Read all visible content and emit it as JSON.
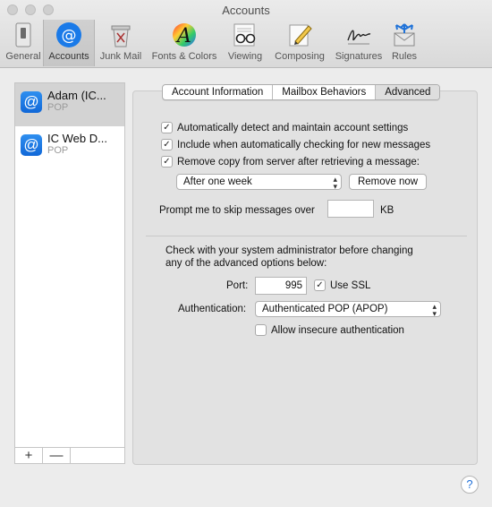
{
  "window": {
    "title": "Accounts"
  },
  "toolbar": {
    "tabs": [
      {
        "label": "General",
        "icon": "switch-icon",
        "selected": false
      },
      {
        "label": "Accounts",
        "icon": "at-sign-icon",
        "selected": true
      },
      {
        "label": "Junk Mail",
        "icon": "trash-can-icon",
        "selected": false
      },
      {
        "label": "Fonts & Colors",
        "icon": "color-font-icon",
        "selected": false
      },
      {
        "label": "Viewing",
        "icon": "glasses-icon",
        "selected": false
      },
      {
        "label": "Composing",
        "icon": "pencil-icon",
        "selected": false
      },
      {
        "label": "Signatures",
        "icon": "signature-icon",
        "selected": false
      },
      {
        "label": "Rules",
        "icon": "rules-envelope-icon",
        "selected": false
      }
    ]
  },
  "sidebar": {
    "accounts": [
      {
        "name": "Adam (IC...",
        "type": "POP",
        "selected": true
      },
      {
        "name": "IC Web D...",
        "type": "POP",
        "selected": false
      }
    ],
    "add_label": "+",
    "remove_label": "—"
  },
  "panel": {
    "segments": [
      {
        "label": "Account Information",
        "selected": false
      },
      {
        "label": "Mailbox Behaviors",
        "selected": false
      },
      {
        "label": "Advanced",
        "selected": true
      }
    ],
    "checkboxes": [
      {
        "label": "Automatically detect and maintain account settings",
        "checked": true
      },
      {
        "label": "Include when automatically checking for new messages",
        "checked": true
      },
      {
        "label": "Remove copy from server after retrieving a message:",
        "checked": true
      }
    ],
    "remove_after": {
      "value": "After one week"
    },
    "remove_now_label": "Remove now",
    "skip_prompt": {
      "label": "Prompt me to skip messages over",
      "value": "",
      "unit": "KB"
    },
    "admin_note": [
      "Check with your system administrator before changing",
      "any of the advanced options below:"
    ],
    "port": {
      "label": "Port:",
      "value": "995"
    },
    "use_ssl": {
      "label": "Use SSL",
      "checked": true
    },
    "authentication": {
      "label": "Authentication:",
      "value": "Authenticated POP (APOP)"
    },
    "allow_insecure": {
      "label": "Allow insecure authentication",
      "checked": false
    }
  },
  "help_label": "?"
}
